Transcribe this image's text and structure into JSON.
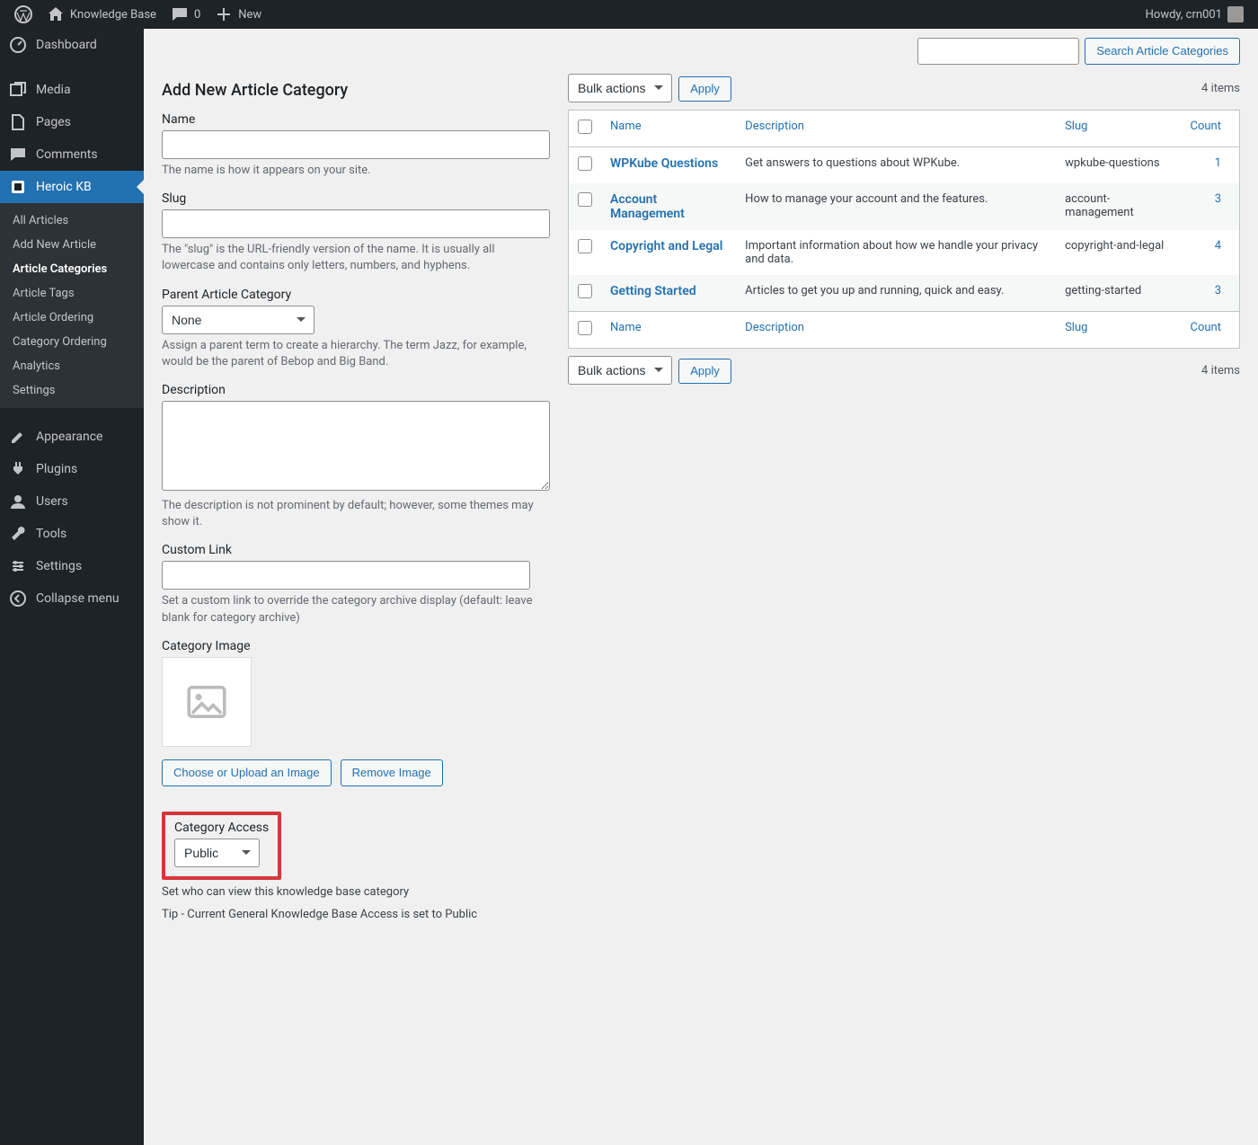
{
  "adminbar": {
    "site_name": "Knowledge Base",
    "comments_count": "0",
    "new_label": "New",
    "howdy": "Howdy, crn001"
  },
  "sidebar": {
    "items": [
      {
        "label": "Dashboard"
      },
      {
        "label": "Media"
      },
      {
        "label": "Pages"
      },
      {
        "label": "Comments"
      },
      {
        "label": "Heroic KB",
        "current": true
      },
      {
        "label": "Appearance"
      },
      {
        "label": "Plugins"
      },
      {
        "label": "Users"
      },
      {
        "label": "Tools"
      },
      {
        "label": "Settings"
      }
    ],
    "submenu": [
      {
        "label": "All Articles"
      },
      {
        "label": "Add New Article"
      },
      {
        "label": "Article Categories",
        "current": true
      },
      {
        "label": "Article Tags"
      },
      {
        "label": "Article Ordering"
      },
      {
        "label": "Category Ordering"
      },
      {
        "label": "Analytics"
      },
      {
        "label": "Settings"
      }
    ],
    "collapse": "Collapse menu"
  },
  "search": {
    "button": "Search Article Categories"
  },
  "form": {
    "title": "Add New Article Category",
    "name_label": "Name",
    "name_desc": "The name is how it appears on your site.",
    "slug_label": "Slug",
    "slug_desc": "The \"slug\" is the URL-friendly version of the name. It is usually all lowercase and contains only letters, numbers, and hyphens.",
    "parent_label": "Parent Article Category",
    "parent_value": "None",
    "parent_desc": "Assign a parent term to create a hierarchy. The term Jazz, for example, would be the parent of Bebop and Big Band.",
    "desc_label": "Description",
    "desc_desc": "The description is not prominent by default; however, some themes may show it.",
    "custom_link_label": "Custom Link",
    "custom_link_desc": "Set a custom link to override the category archive display (default: leave blank for category archive)",
    "cat_image_label": "Category Image",
    "choose_image_btn": "Choose or Upload an Image",
    "remove_image_btn": "Remove Image",
    "access_label": "Category Access",
    "access_value": "Public",
    "access_desc": "Set who can view this knowledge base category",
    "access_tip": "Tip - Current General Knowledge Base Access is set to Public"
  },
  "table": {
    "bulk_label": "Bulk actions",
    "apply_label": "Apply",
    "items_count": "4 items",
    "cols": {
      "name": "Name",
      "desc": "Description",
      "slug": "Slug",
      "count": "Count"
    },
    "rows": [
      {
        "name": "WPKube Questions",
        "desc": "Get answers to questions about WPKube.",
        "slug": "wpkube-questions",
        "count": "1"
      },
      {
        "name": "Account Management",
        "desc": "How to manage your account and the features.",
        "slug": "account-management",
        "count": "3"
      },
      {
        "name": "Copyright and Legal",
        "desc": "Important information about how we handle your privacy and data.",
        "slug": "copyright-and-legal",
        "count": "4"
      },
      {
        "name": "Getting Started",
        "desc": "Articles to get you up and running, quick and easy.",
        "slug": "getting-started",
        "count": "3"
      }
    ]
  }
}
